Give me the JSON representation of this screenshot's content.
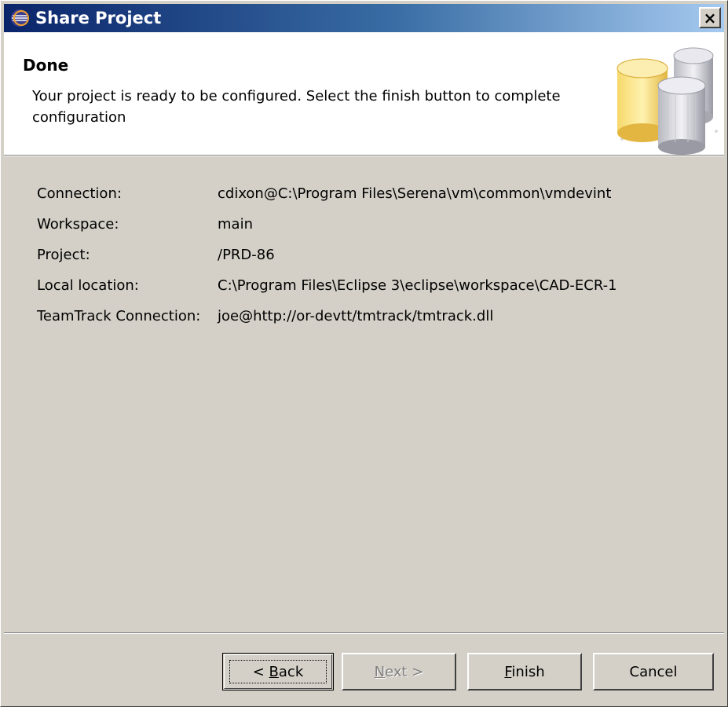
{
  "window": {
    "title": "Share Project",
    "close_label": "×"
  },
  "header": {
    "title": "Done",
    "description": "Your project is ready to be configured.  Select the finish button to complete configuration"
  },
  "details": [
    {
      "label": "Connection:",
      "value": "cdixon@C:\\Program Files\\Serena\\vm\\common\\vmdevint"
    },
    {
      "label": "Workspace:",
      "value": "main"
    },
    {
      "label": "Project:",
      "value": "/PRD-86"
    },
    {
      "label": "Local location:",
      "value": "C:\\Program Files\\Eclipse 3\\eclipse\\workspace\\CAD-ECR-1"
    },
    {
      "label": "TeamTrack Connection:",
      "value": "joe@http://or-devtt/tmtrack/tmtrack.dll"
    }
  ],
  "buttons": {
    "back": {
      "prefix": "< ",
      "mnemonic": "B",
      "rest": "ack"
    },
    "next": {
      "mnemonic": "N",
      "rest": "ext >"
    },
    "finish": {
      "mnemonic": "F",
      "rest": "inish"
    },
    "cancel": {
      "label": "Cancel"
    }
  },
  "colors": {
    "titlebar_start": "#0a246a",
    "titlebar_end": "#a6caf0",
    "dialog_bg": "#d4d0c8"
  },
  "icons": {
    "title": "eclipse-icon",
    "banner": "database-cylinders-icon"
  }
}
